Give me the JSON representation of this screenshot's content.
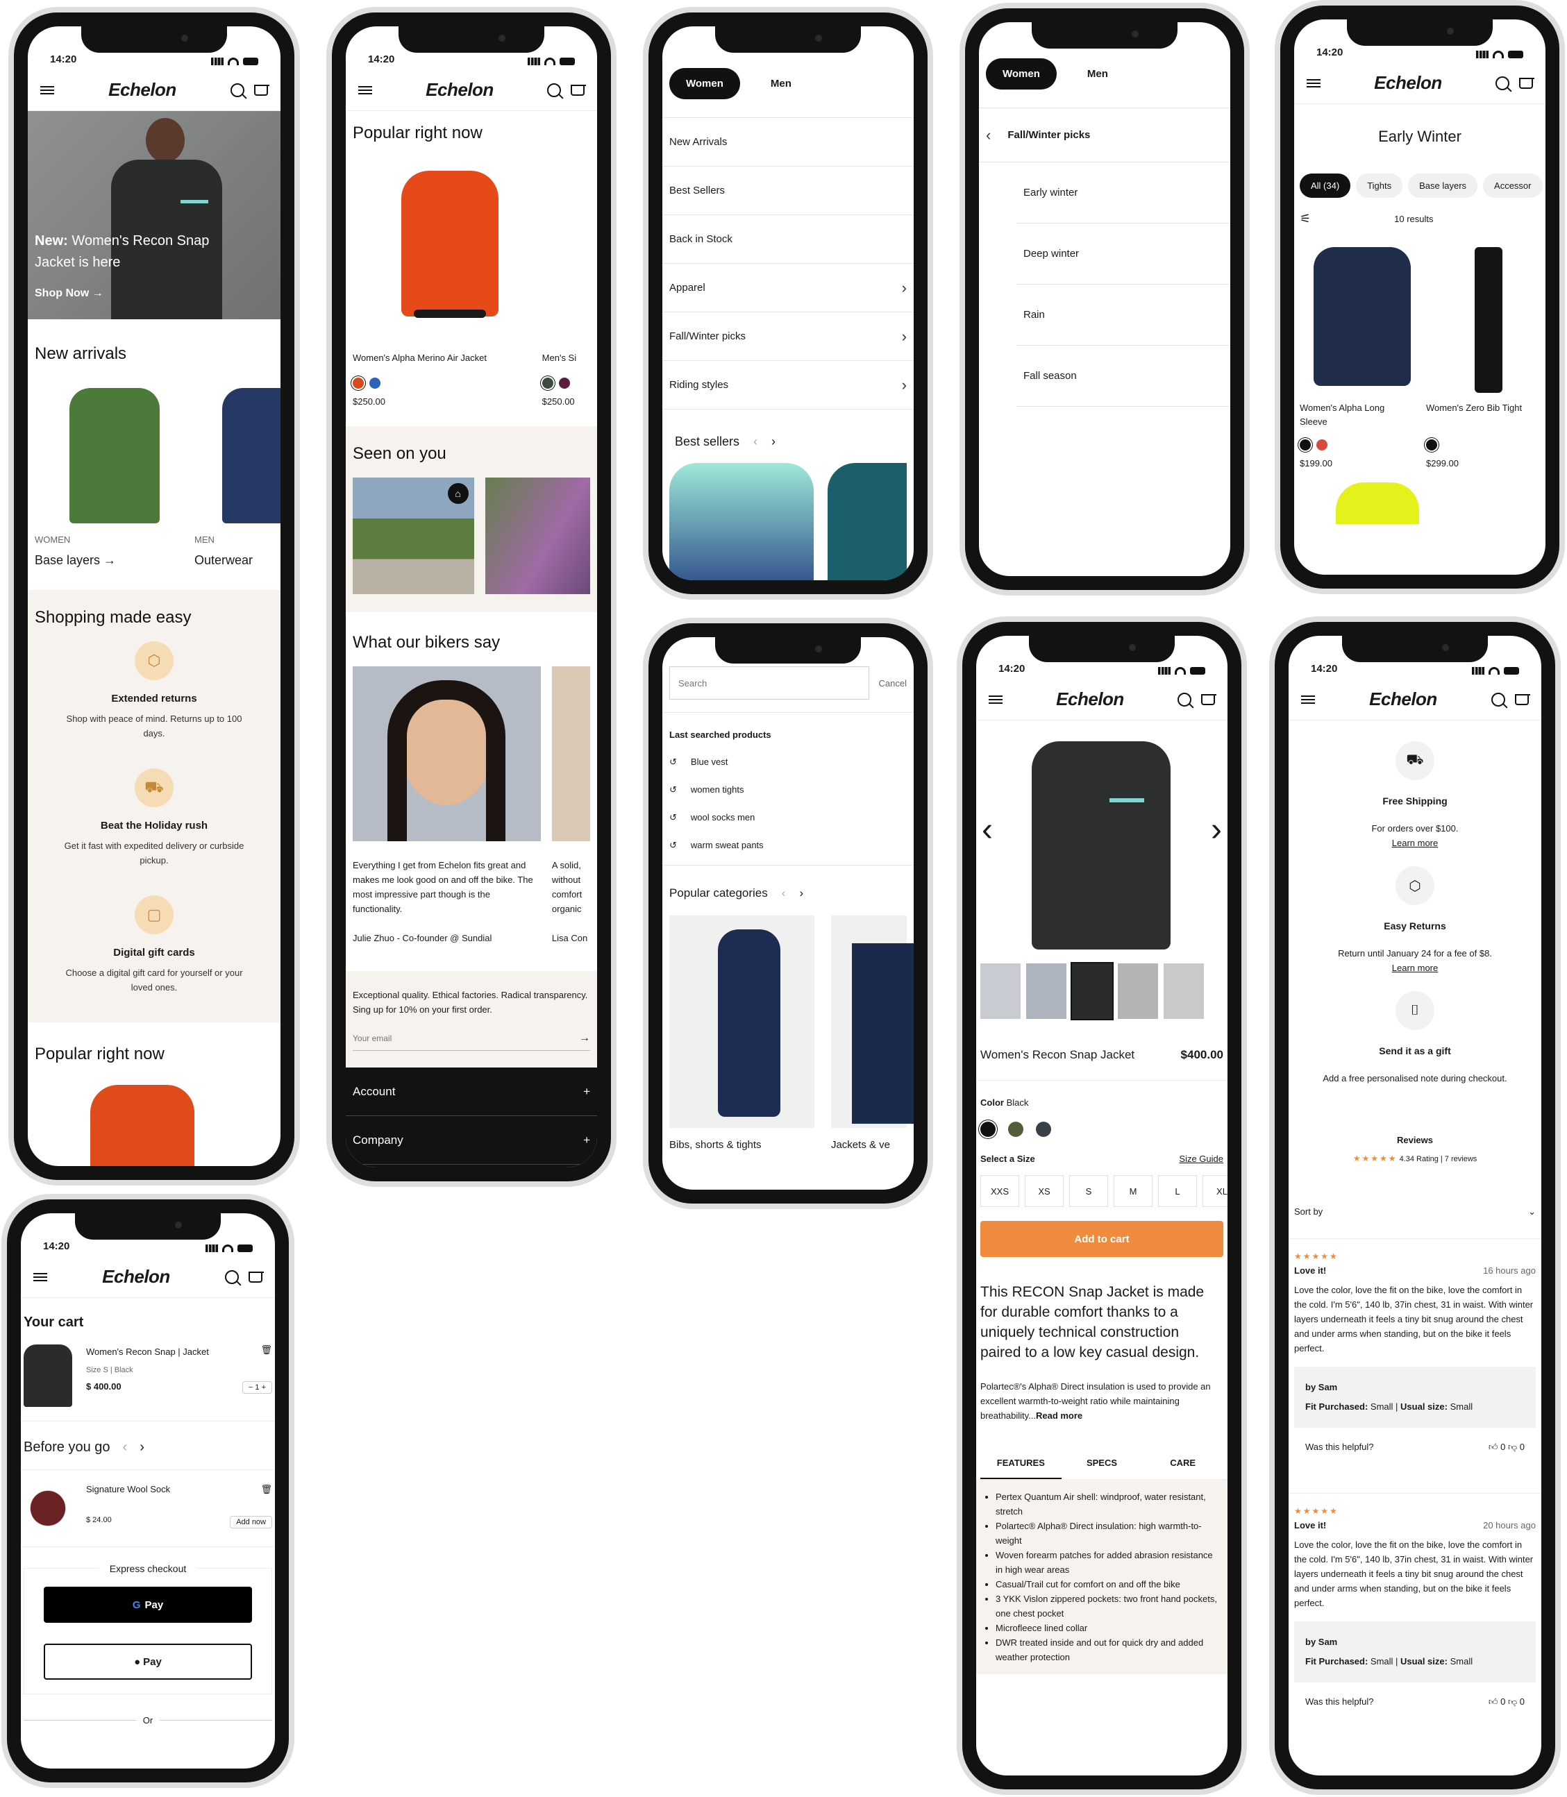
{
  "status": {
    "time": "14:20"
  },
  "brand": {
    "logo": "Echelon"
  },
  "colors": {
    "accent": "#f08a3c",
    "dark": "#121212",
    "beige": "#f6f3ee"
  },
  "home": {
    "hero_label": "New:",
    "hero_text": "Women's Recon Snap Jacket is here",
    "hero_cta": "Shop Now",
    "new_arrivals": "New arrivals",
    "cat1_tag": "WOMEN",
    "cat1": "Base layers",
    "cat2_tag": "MEN",
    "cat2": "Outerwear",
    "shopping_title": "Shopping made easy",
    "features": [
      {
        "title": "Extended returns",
        "text": "Shop with peace of mind. Returns up to 100 days."
      },
      {
        "title": "Beat the Holiday rush",
        "text": "Get it fast with expedited delivery or curbside pickup."
      },
      {
        "title": "Digital gift cards",
        "text": "Choose a digital gift card for yourself or your loved ones."
      }
    ],
    "popular": "Popular right now"
  },
  "home2": {
    "popular": "Popular right now",
    "p1_name": "Women's Alpha Merino Air Jacket",
    "p1_price": "$250.00",
    "p2_name": "Men's Si",
    "p2_price": "$250.00",
    "seen": "Seen on you",
    "say": "What our bikers say",
    "quote": "Everything I get from Echelon fits great and makes me look good on and off the bike. The most impressive part though is the functionality.",
    "quote_by": "Julie Zhuo - Co-founder @ Sundial",
    "quote2": "A solid, without comfort organic",
    "quote2_by": "Lisa Con",
    "newsletter": "Exceptional quality. Ethical factories. Radical transparency. Sing up for 10% on your first order.",
    "email_placeholder": "Your email",
    "footer1": "Account",
    "footer2": "Company"
  },
  "menu": {
    "tab_women": "Women",
    "tab_men": "Men",
    "items": [
      "New Arrivals",
      "Best Sellers",
      "Back in Stock",
      "Apparel",
      "Fall/Winter picks",
      "Riding styles"
    ],
    "best_sellers": "Best sellers"
  },
  "submenu": {
    "tab_women": "Women",
    "tab_men": "Men",
    "back": "Fall/Winter picks",
    "items": [
      "Early winter",
      "Deep winter",
      "Rain",
      "Fall season"
    ]
  },
  "listing": {
    "title": "Early Winter",
    "chips": [
      "All (34)",
      "Tights",
      "Base layers",
      "Accessor"
    ],
    "results": "10 results",
    "p1_name": "Women's Alpha Long Sleeve",
    "p1_price": "$199.00",
    "p2_name": "Women's Zero Bib Tight",
    "p2_price": "$299.00"
  },
  "search": {
    "placeholder": "Search",
    "cancel": "Cancel",
    "last": "Last searched products",
    "recent": [
      "Blue vest",
      "women tights",
      "wool socks men",
      "warm sweat pants"
    ],
    "popular_cats": "Popular categories",
    "cat1": "Bibs, shorts & tights",
    "cat2": "Jackets & ve"
  },
  "pdp": {
    "name": "Women's Recon Snap Jacket",
    "price": "$400.00",
    "color_label": "Color",
    "color_value": "Black",
    "size_label": "Select a Size",
    "size_guide": "Size Guide",
    "sizes": [
      "XXS",
      "XS",
      "S",
      "M",
      "L",
      "XL"
    ],
    "add": "Add to cart",
    "desc": "This RECON Snap Jacket is made for durable comfort thanks to a uniquely technical construction paired to a low key casual design.",
    "desc2": "Polartec®'s Alpha® Direct insulation is used to provide an excellent warmth-to-weight ratio while maintaining breathability...",
    "read_more": "Read more",
    "tabs": [
      "FEATURES",
      "SPECS",
      "CARE"
    ],
    "features": [
      "Pertex Quantum Air shell: windproof, water resistant, stretch",
      "Polartec® Alpha® Direct insulation: high warmth-to-weight",
      "Woven forearm patches for added abrasion resistance in high wear areas",
      "Casual/Trail cut for comfort on and off the bike",
      "3 YKK Vislon zippered pockets: two front hand pockets, one chest pocket",
      "Microfleece lined collar",
      "DWR treated inside and out for quick dry and added weather protection"
    ]
  },
  "info": {
    "ship_title": "Free Shipping",
    "ship_text": "For orders over $100.",
    "learn": "Learn more",
    "ret_title": "Easy Returns",
    "ret_text": "Return until January 24 for a fee of $8.",
    "gift_title": "Send it as a gift",
    "gift_text": "Add a free personalised note during checkout.",
    "reviews": "Reviews",
    "rating": "4.34 Rating | 7 reviews",
    "sort": "Sort by",
    "r_title": "Love it!",
    "r1_time": "16 hours ago",
    "r2_time": "20 hours ago",
    "r_text": "Love the color, love the fit on the bike, love the comfort in the cold. I'm 5'6\", 140 lb, 37in chest, 31 in waist. With winter layers underneath it feels a tiny bit snug around the chest and under arms when standing, but on the bike it feels perfect.",
    "by": "by Sam",
    "fit_label": "Fit Purchased:",
    "fit": "Small",
    "usual_label": "Usual size:",
    "usual": "Small",
    "helpful": "Was this helpful?",
    "yes": "0",
    "no": "0"
  },
  "cart": {
    "title": "Your cart",
    "item": "Women's Recon Snap | Jacket",
    "meta": "Size S | Black",
    "price": "$ 400.00",
    "qty": "1",
    "before": "Before you go",
    "sock": "Signature Wool Sock",
    "sock_price": "$ 24.00",
    "add_now": "Add now",
    "express": "Express checkout",
    "gpay": "Pay",
    "apay": "Pay",
    "or": "Or"
  }
}
